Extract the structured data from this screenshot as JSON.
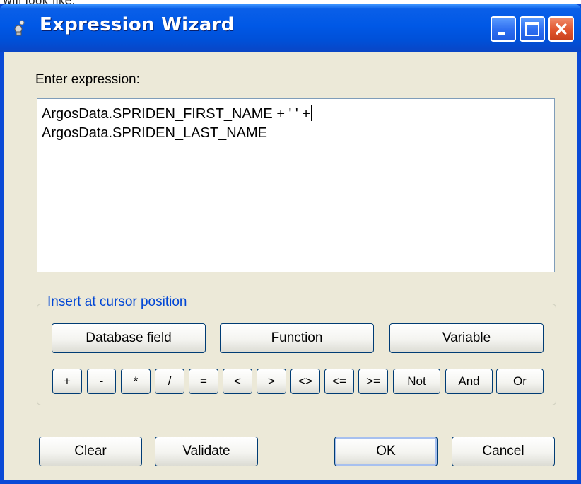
{
  "window": {
    "title": "Expression Wizard",
    "page_fragment": "will look like:",
    "accent": "#0058e6",
    "close_color": "#e0552e"
  },
  "prompt": {
    "label": "Enter expression:"
  },
  "expression": {
    "line1": "ArgosData.SPRIDEN_FIRST_NAME + ' ' +",
    "line2": "ArgosData.SPRIDEN_LAST_NAME"
  },
  "insert_group": {
    "label": "Insert at cursor position",
    "database_field": "Database field",
    "function": "Function",
    "variable": "Variable",
    "operators": [
      "+",
      "-",
      "*",
      "/",
      "=",
      "<",
      ">",
      "<>",
      "<=",
      ">=",
      "Not",
      "And",
      "Or"
    ]
  },
  "footer": {
    "clear": "Clear",
    "validate": "Validate",
    "ok": "OK",
    "cancel": "Cancel"
  },
  "icons": [
    "app-icon",
    "minimize-icon",
    "maximize-icon",
    "close-icon"
  ]
}
